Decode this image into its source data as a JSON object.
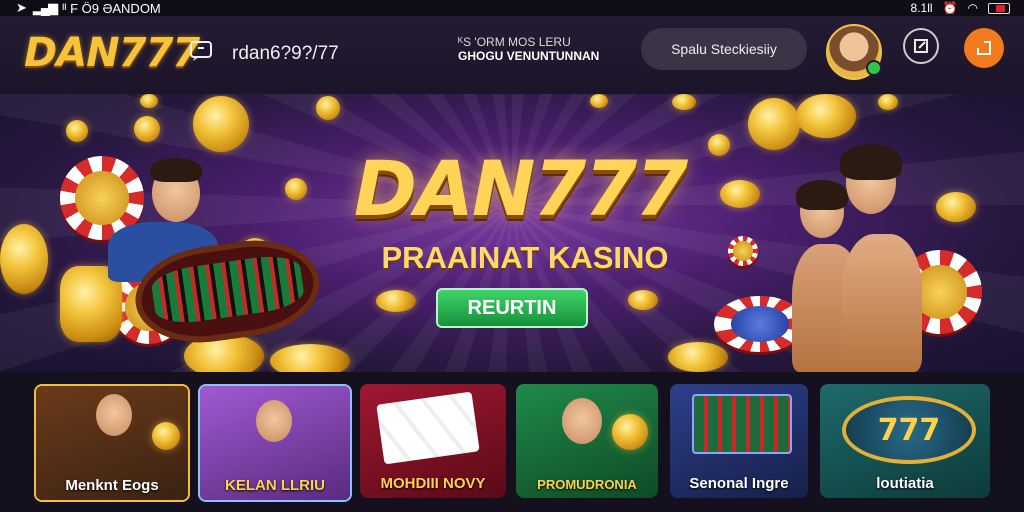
{
  "status_bar": {
    "carrier": "ᴵᴵ F Ö9 ƏANDOM",
    "right_text": "8.1ll"
  },
  "header": {
    "logo": "DAN777",
    "username": "rdan6?9?/77",
    "promo_line1": "ᴷS 'ORM MOS LERU",
    "promo_line2": "GHOGU VENUNTUNNAN",
    "search_label": "Spalu Steckiesiiy"
  },
  "banner": {
    "title": "DAN777",
    "subtitle": "PRAAINAT KASINO",
    "cta_label": "REURTIN"
  },
  "games": [
    {
      "label": "Menknt Eogs"
    },
    {
      "label": "KELAN LLRIU"
    },
    {
      "label": "MOHDIII NOVY"
    },
    {
      "label": "PROMUDRONIA"
    },
    {
      "label": "Senonal Ingre"
    },
    {
      "label": "loutiatia"
    }
  ],
  "colors": {
    "accent_gold": "#f6c33a",
    "cta_green": "#16913a",
    "share_orange": "#f07a1c"
  }
}
